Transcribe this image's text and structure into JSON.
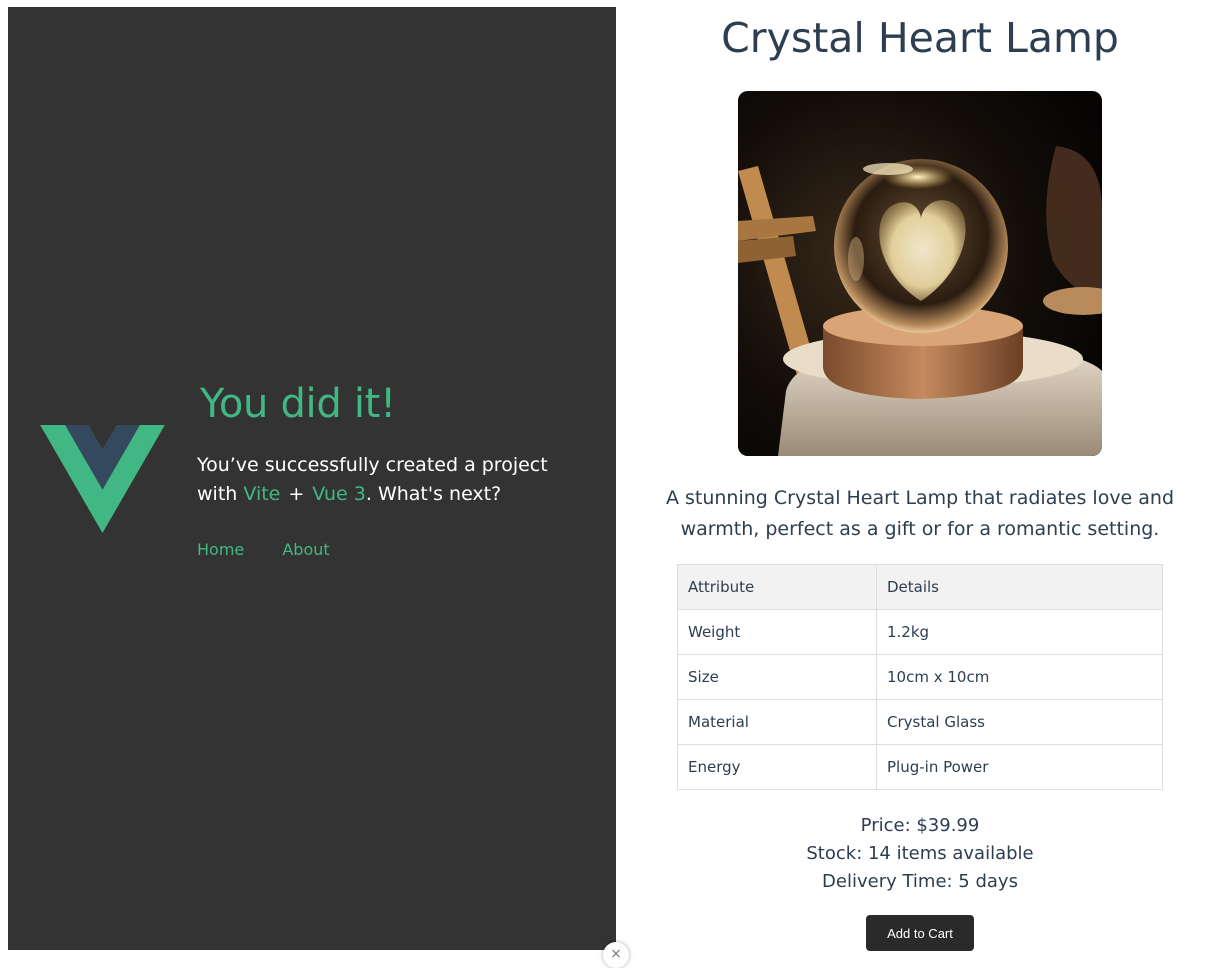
{
  "hero": {
    "heading": "You did it!",
    "subtitle_prefix": "You’ve successfully created a project with",
    "vite_link": "Vite",
    "plus": "+",
    "vue_link": "Vue 3",
    "subtitle_suffix": ". What's next?"
  },
  "nav": {
    "home": "Home",
    "about": "About"
  },
  "product": {
    "title": "Crystal Heart Lamp",
    "image_alt": "Crystal Heart Lamp",
    "description": "A stunning Crystal Heart Lamp that radiates love and warmth, perfect as a gift or for a romantic setting.",
    "table": {
      "headers": [
        "Attribute",
        "Details"
      ],
      "rows": [
        [
          "Weight",
          "1.2kg"
        ],
        [
          "Size",
          "10cm x 10cm"
        ],
        [
          "Material",
          "Crystal Glass"
        ],
        [
          "Energy",
          "Plug-in Power"
        ]
      ]
    },
    "price": "Price: $39.99",
    "stock": "Stock: 14 items available",
    "delivery": "Delivery Time: 5 days",
    "add_to_cart": "Add to Cart"
  },
  "overlay": {
    "close_glyph": "×"
  },
  "colors": {
    "vue_green": "#41b883",
    "vue_navy": "#35495e",
    "panel_bg": "#333333",
    "text_dark": "#2c3e50"
  },
  "icons": {
    "logo": "vue-logo-icon",
    "close": "close-icon"
  }
}
